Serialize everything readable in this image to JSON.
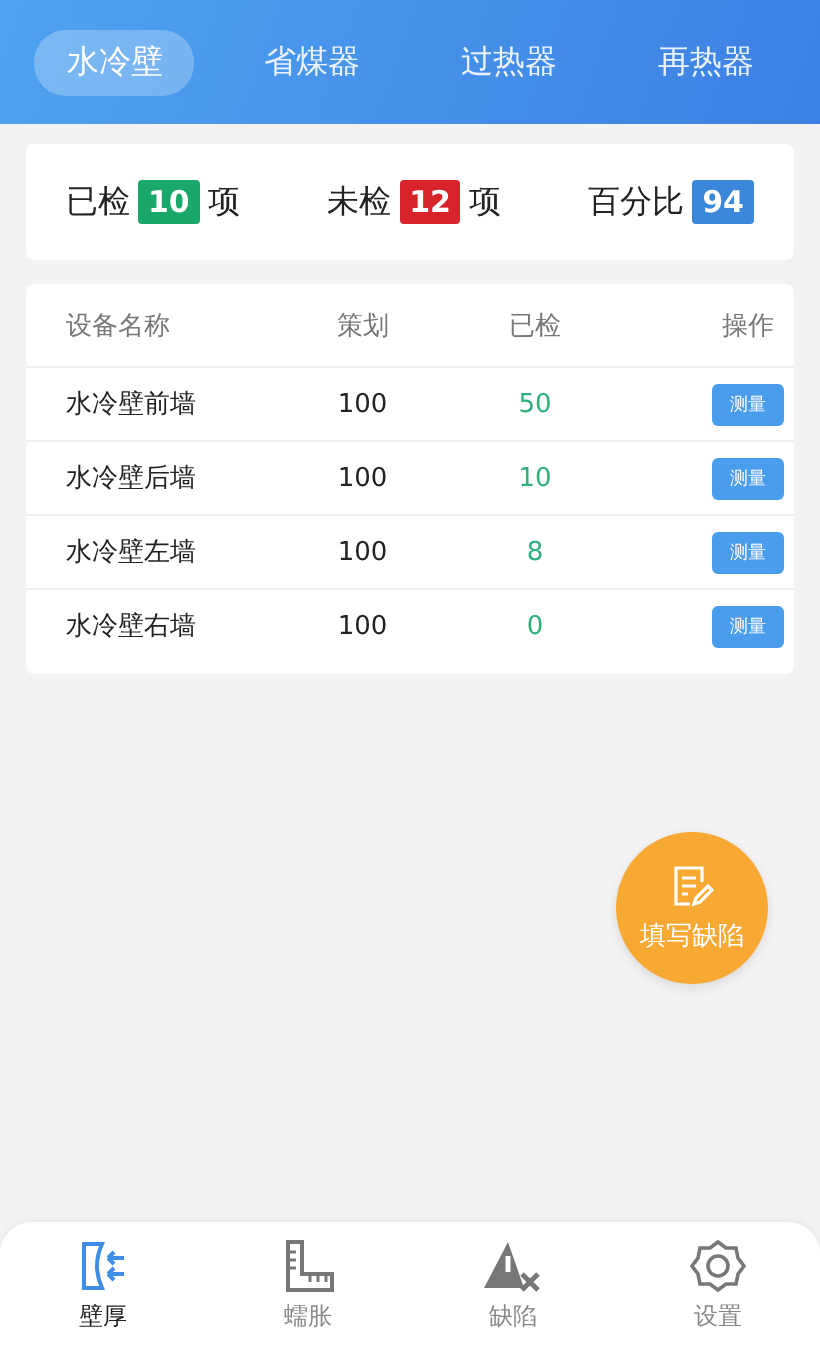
{
  "tabs": [
    {
      "label": "水冷壁",
      "selected": true
    },
    {
      "label": "省煤器",
      "selected": false
    },
    {
      "label": "过热器",
      "selected": false
    },
    {
      "label": "再热器",
      "selected": false
    }
  ],
  "stats": [
    {
      "label": "已检",
      "value": "10",
      "unit": "项",
      "color": "#1aa86a"
    },
    {
      "label": "未检",
      "value": "12",
      "unit": "项",
      "color": "#d8232a"
    },
    {
      "label": "百分比",
      "value": "94",
      "color": "#3a87dc"
    }
  ],
  "table": {
    "columns": [
      "设备名称",
      "策划",
      "已检",
      "操作"
    ],
    "rows": [
      {
        "name": "水冷壁前墙",
        "planned": "100",
        "checked": "50",
        "action": "测量"
      },
      {
        "name": "水冷壁后墙",
        "planned": "100",
        "checked": "10",
        "action": "测量"
      },
      {
        "name": "水冷壁左墙",
        "planned": "100",
        "checked": "8",
        "action": "测量"
      },
      {
        "name": "水冷壁右墙",
        "planned": "100",
        "checked": "0",
        "action": "测量"
      }
    ]
  },
  "fab": {
    "label": "填写缺陷"
  },
  "nav": [
    {
      "label": "壁厚",
      "kind": "thickness",
      "selected": true
    },
    {
      "label": "蠕胀",
      "kind": "ruler",
      "selected": false
    },
    {
      "label": "缺陷",
      "kind": "warning",
      "selected": false
    },
    {
      "label": "设置",
      "kind": "gear",
      "selected": false
    }
  ]
}
